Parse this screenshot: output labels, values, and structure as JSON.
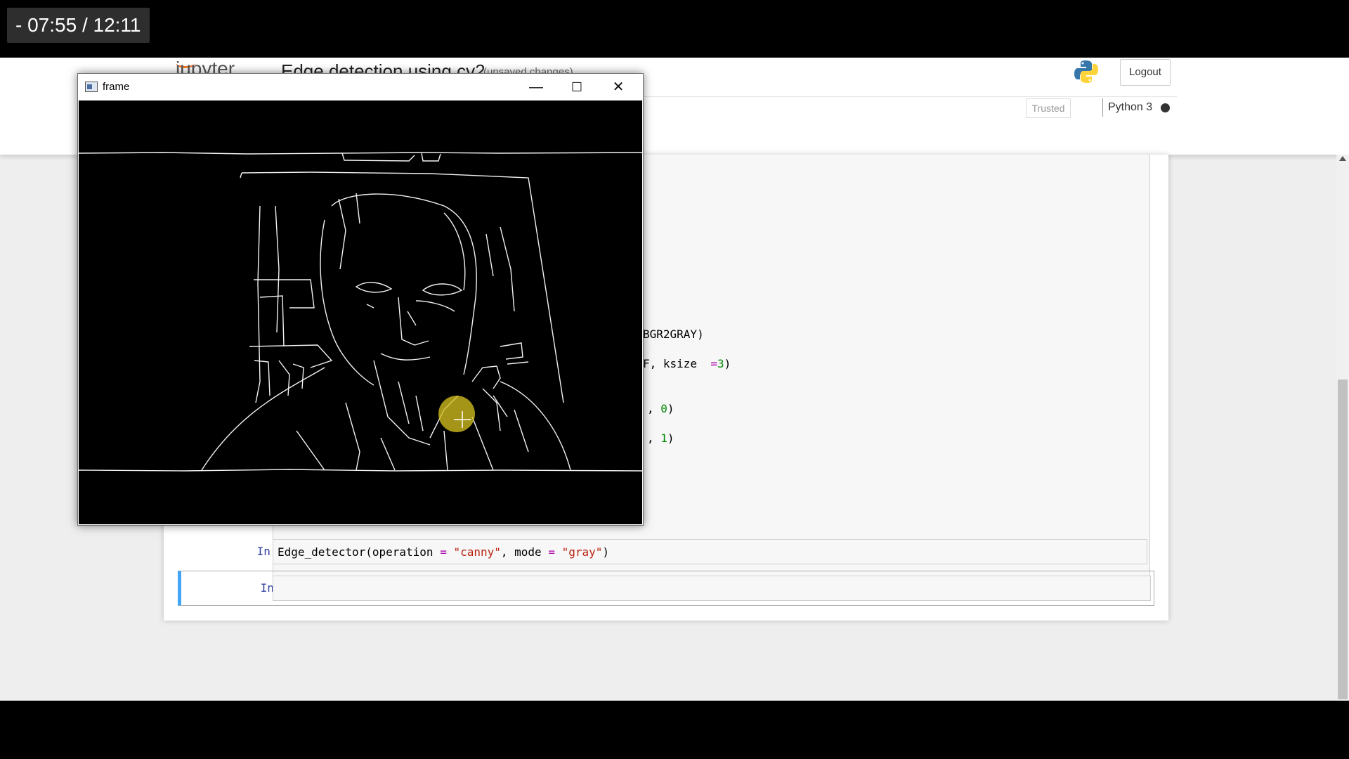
{
  "video": {
    "timecode": "- 07:55 / 12:11"
  },
  "jupyter": {
    "logo_text": "jupyter",
    "notebook_title": "Edge detection using cv2",
    "save_status": "(unsaved changes)",
    "logout_label": "Logout",
    "trusted_label": "Trusted",
    "kernel_name": "Python 3"
  },
  "code_fragments": {
    "line1": "BGR2GRAY)",
    "line2_a": "F, ksize  ",
    "line2_op": "=",
    "line2_num": "3",
    "line2_end": ")",
    "line3_a": ", ",
    "line3_num": "0",
    "line3_end": ")",
    "line4_a": ", ",
    "line4_num": "1",
    "line4_end": ")"
  },
  "cells": [
    {
      "prompt": "In [*]:",
      "code_fn": "Edge_detector(operation ",
      "code_op1": "=",
      "code_str1": " \"canny\"",
      "code_mid": ", mode ",
      "code_op2": "=",
      "code_str2": " \"gray\"",
      "code_end": ")"
    },
    {
      "prompt": "In [ ]:",
      "code": ""
    }
  ],
  "frame_window": {
    "title": "frame",
    "minimize": "—",
    "maximize": "☐",
    "close": "✕"
  },
  "colors": {
    "selected_cell_accent": "#42a5f5",
    "cursor_highlight": "#d2be1e",
    "python_blue": "#3776ab",
    "python_yellow": "#ffd43b"
  }
}
